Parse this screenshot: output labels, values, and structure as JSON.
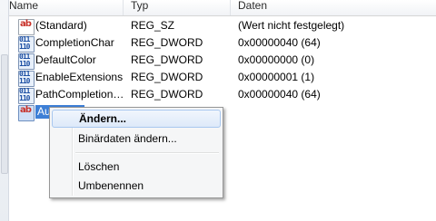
{
  "columns": {
    "name": "Name",
    "type": "Typ",
    "data": "Daten"
  },
  "rows": [
    {
      "icon": "string-value-icon",
      "name": "(Standard)",
      "type": "REG_SZ",
      "data": "(Wert nicht festgelegt)"
    },
    {
      "icon": "binary-value-icon",
      "name": "CompletionChar",
      "type": "REG_DWORD",
      "data": "0x00000040 (64)"
    },
    {
      "icon": "binary-value-icon",
      "name": "DefaultColor",
      "type": "REG_DWORD",
      "data": "0x00000000 (0)"
    },
    {
      "icon": "binary-value-icon",
      "name": "EnableExtensions",
      "type": "REG_DWORD",
      "data": "0x00000001 (1)"
    },
    {
      "icon": "binary-value-icon",
      "name": "PathCompletion…",
      "type": "REG_DWORD",
      "data": "0x00000040 (64)"
    },
    {
      "icon": "string-value-icon",
      "name": "Au…",
      "type": "",
      "data": ""
    }
  ],
  "context_menu": {
    "items": [
      {
        "label": "Ändern...",
        "bold": true,
        "highlighted": true
      },
      {
        "label": "Binärdaten ändern..."
      },
      {
        "label": "Löschen"
      },
      {
        "label": "Umbenennen"
      }
    ]
  },
  "colors": {
    "selection": "#3d7fd6",
    "menu_hover_border": "#a8c7ef",
    "string_icon_text": "#c8322a",
    "binary_icon_text": "#1d4fa3"
  }
}
